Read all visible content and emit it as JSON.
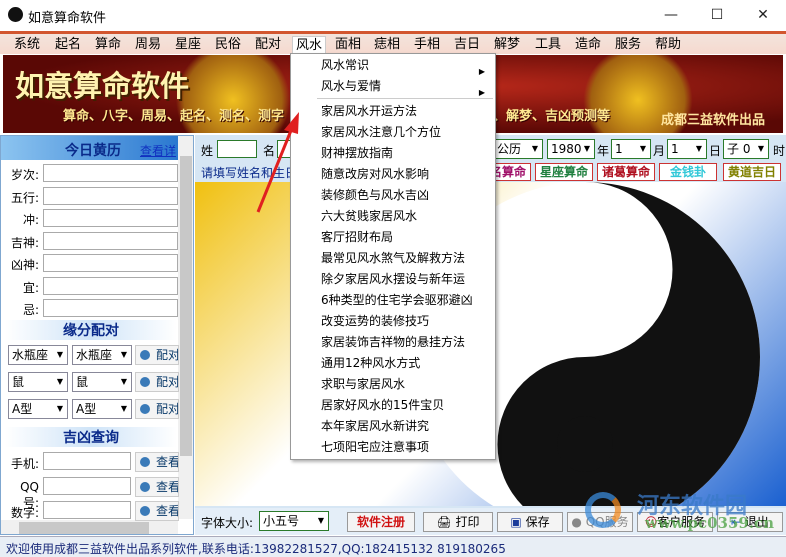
{
  "window": {
    "title": "如意算命软件",
    "controls": [
      "—",
      "☐",
      "✕"
    ]
  },
  "menu": [
    "系统",
    "起名",
    "算命",
    "周易",
    "星座",
    "民俗",
    "配对",
    "风水",
    "面相",
    "痣相",
    "手相",
    "吉日",
    "解梦",
    "工具",
    "造命",
    "服务",
    "帮助"
  ],
  "banner": {
    "title": "如意算命软件",
    "subtitle": "算命、八字、周易、起名、测名、测字",
    "subtitle_right": "、解梦、吉凶预测等",
    "brand": "成都三益软件出品"
  },
  "left": {
    "huangli": {
      "title": "今日黄历",
      "link": "查看详",
      "labels": [
        "岁次:",
        "五行:",
        "冲:",
        "吉神:",
        "凶神:",
        "宜:",
        "忌:"
      ]
    },
    "pairing": {
      "title": "缘分配对",
      "rows": [
        [
          "水瓶座",
          "水瓶座"
        ],
        [
          "鼠",
          "鼠"
        ],
        [
          "A型",
          "A型"
        ]
      ],
      "button": "配对"
    },
    "lookup": {
      "title": "吉凶查询",
      "labels": [
        "手机:",
        "QQ号:",
        "数字:"
      ],
      "button": "查看"
    }
  },
  "right": {
    "surname_label": "姓",
    "name_label": "名",
    "hint": "请填写姓名和生日",
    "calendar": "公历",
    "year": "1980",
    "year_label": "年",
    "month": "1",
    "month_label": "月",
    "day": "1",
    "day_label": "日",
    "hour": "子 0",
    "hour_label": "时",
    "buttons": [
      {
        "label": "名算命",
        "color": "#a0106a"
      },
      {
        "label": "星座算命",
        "color": "#208040"
      },
      {
        "label": "诸葛算命",
        "color": "#b01020"
      },
      {
        "label": "金钱卦",
        "color": "#30c8d8"
      },
      {
        "label": "黄道吉日",
        "color": "#808000"
      }
    ],
    "toolbar": {
      "font_size_label": "字体大小:",
      "font_size": "小五号",
      "register": "软件注册",
      "print": "打印",
      "save": "保存",
      "qq": "QQ服务",
      "service": "客户服务",
      "exit": "退出"
    }
  },
  "status": "欢迎使用成都三益软件出品系列软件,联系电话:13982281527,QQ:182415132 819180265",
  "dropdown": {
    "submenus": [
      "风水常识",
      "风水与爱情"
    ],
    "items": [
      "家居风水开运方法",
      "家居风水注意几个方位",
      "财神摆放指南",
      "随意改房对风水影响",
      "装修颜色与风水吉凶",
      "六大贫贱家居风水",
      "客厅招财布局",
      "最常见风水煞气及解救方法",
      "除夕家居风水摆设与新年运",
      "6种类型的住宅学会驱邪避凶",
      "改变运势的装修技巧",
      "家居装饰吉祥物的悬挂方法",
      "通用12种风水方式",
      "求职与家居风水",
      "居家好风水的15件宝贝",
      "本年家居风水新讲究",
      "七项阳宅应注意事项"
    ]
  },
  "watermark": {
    "text": "河东软件园",
    "url": "www.pc0359.cn"
  }
}
